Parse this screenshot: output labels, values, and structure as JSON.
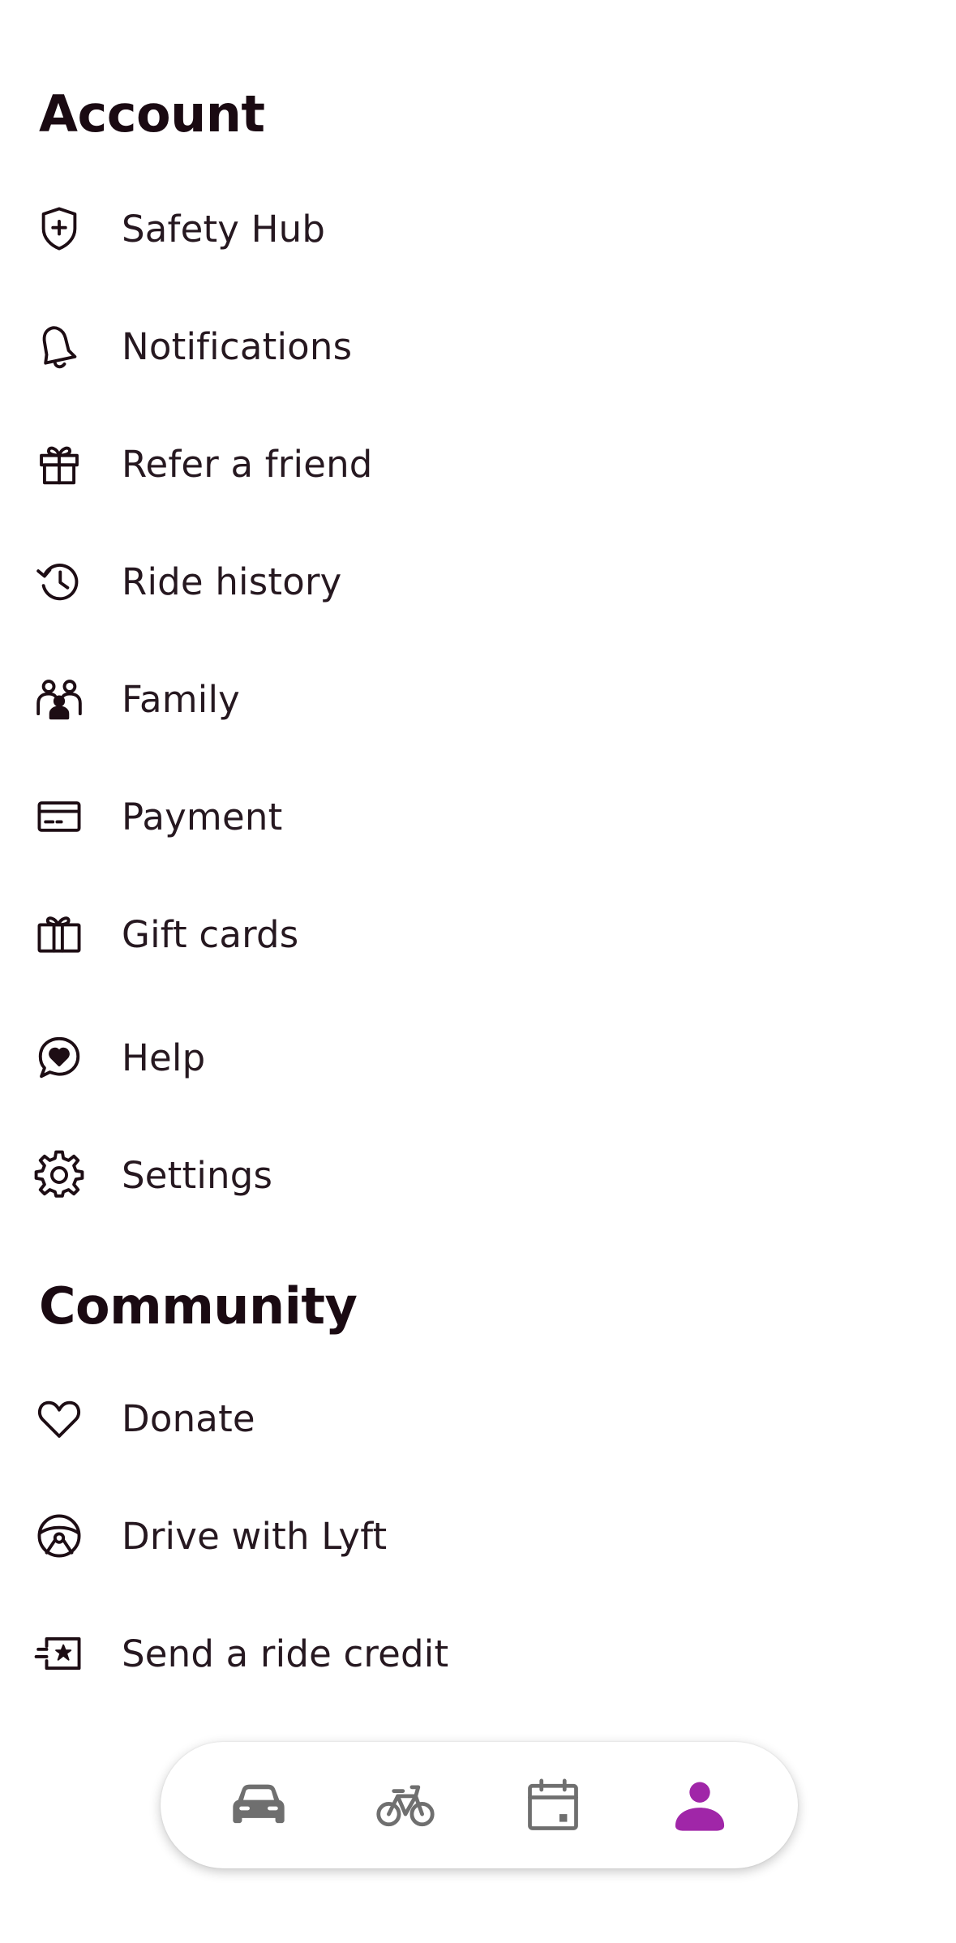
{
  "account": {
    "title": "Account",
    "items": [
      {
        "label": "Safety Hub",
        "icon": "shield-plus-icon"
      },
      {
        "label": "Notifications",
        "icon": "bell-icon"
      },
      {
        "label": "Refer a friend",
        "icon": "gift-icon"
      },
      {
        "label": "Ride history",
        "icon": "history-clock-icon"
      },
      {
        "label": "Family",
        "icon": "family-icon"
      },
      {
        "label": "Payment",
        "icon": "credit-card-icon"
      },
      {
        "label": "Gift cards",
        "icon": "gift-card-icon"
      },
      {
        "label": "Help",
        "icon": "chat-heart-icon"
      },
      {
        "label": "Settings",
        "icon": "gear-icon"
      }
    ]
  },
  "community": {
    "title": "Community",
    "items": [
      {
        "label": "Donate",
        "icon": "heart-icon"
      },
      {
        "label": "Drive with Lyft",
        "icon": "steering-wheel-icon"
      },
      {
        "label": "Send a ride credit",
        "icon": "ride-credit-star-icon"
      }
    ]
  },
  "nav": {
    "tabs": [
      {
        "name": "rides",
        "icon": "car-icon",
        "active": false
      },
      {
        "name": "bikes",
        "icon": "bicycle-icon",
        "active": false
      },
      {
        "name": "scheduled",
        "icon": "calendar-icon",
        "active": false
      },
      {
        "name": "profile",
        "icon": "person-icon",
        "active": true
      }
    ],
    "active_color": "#a026a8",
    "inactive_color": "#6f6f6f"
  }
}
